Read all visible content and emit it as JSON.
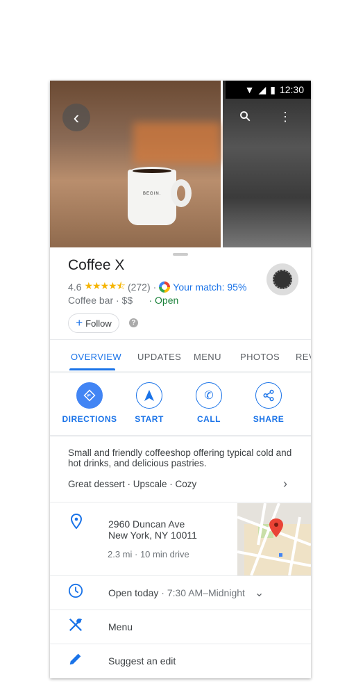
{
  "status_bar": {
    "time": "12:30"
  },
  "place": {
    "name": "Coffee X",
    "rating": "4.6",
    "stars": 4.5,
    "reviews": "(272)",
    "match": "Your match: 95%",
    "category": "Coffee bar · $$",
    "open": "· Open",
    "follow": "Follow",
    "help": "?"
  },
  "photo": {
    "mug_text": "BEGIN."
  },
  "tabs": [
    "OVERVIEW",
    "UPDATES",
    "MENU",
    "PHOTOS",
    "REVIEWS"
  ],
  "actions": [
    "DIRECTIONS",
    "START",
    "CALL",
    "SHARE"
  ],
  "description": "Small and friendly coffeeshop offering typical cold and hot drinks, and delicious pastries.",
  "tags": "Great dessert · Upscale · Cozy",
  "address": {
    "line1": "2960 Duncan Ave",
    "line2": "New York, NY 10011",
    "distance": "2.3 mi · 10 min drive"
  },
  "hours": {
    "label": "Open today",
    "time": "· 7:30 AM–Midnight"
  },
  "menu": "Menu",
  "suggest": "Suggest an edit",
  "colors": {
    "accent": "#1a73e8",
    "open": "#188038",
    "star": "#f5b400",
    "pin": "#ea4335"
  }
}
